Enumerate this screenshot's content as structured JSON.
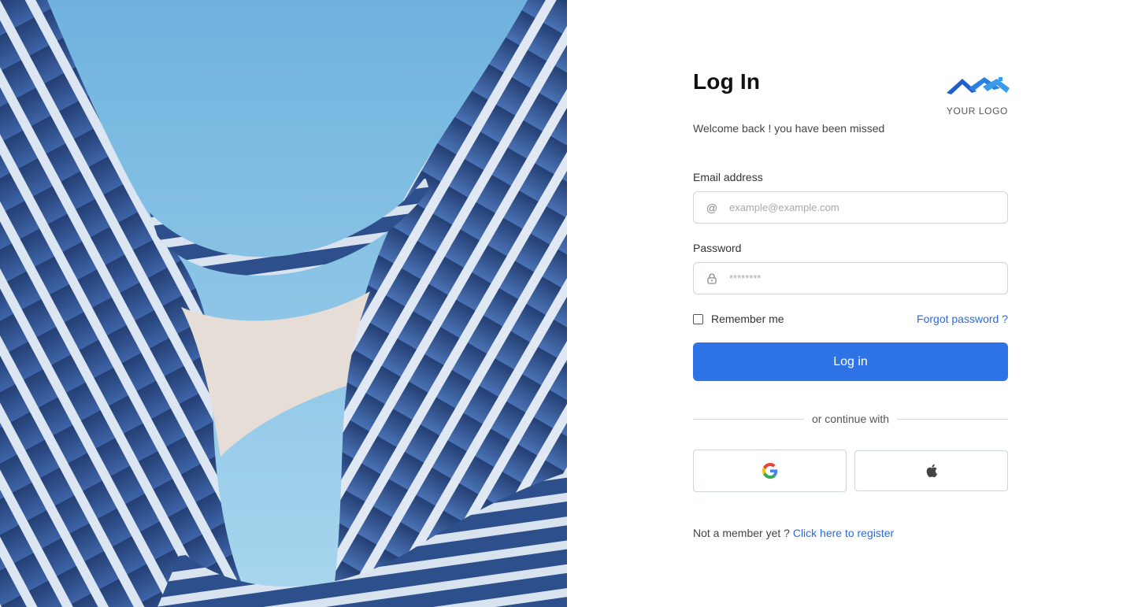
{
  "hero": {
    "image_alt": "curved building facade against blue sky"
  },
  "login": {
    "title": "Log In",
    "subtitle": "Welcome back ! you have been missed",
    "logo_text": "YOUR LOGO",
    "email": {
      "label": "Email address",
      "placeholder": "example@example.com",
      "value": "",
      "icon": "at-icon"
    },
    "password": {
      "label": "Password",
      "placeholder": "********",
      "value": "",
      "icon": "lock-icon"
    },
    "remember_label": "Remember me",
    "remember_checked": false,
    "forgot_label": "Forgot password ?",
    "submit_label": "Log in",
    "divider_text": "or continue with",
    "social": [
      {
        "name": "google",
        "icon": "google-icon"
      },
      {
        "name": "apple",
        "icon": "apple-icon"
      }
    ],
    "register_prompt": "Not a member yet ?",
    "register_link": "Click here to register"
  },
  "colors": {
    "primary": "#2d73e6",
    "link": "#2b6cd8",
    "border": "#cfd4da",
    "logo_dark": "#1f5fc9",
    "logo_light": "#3a9be8"
  }
}
